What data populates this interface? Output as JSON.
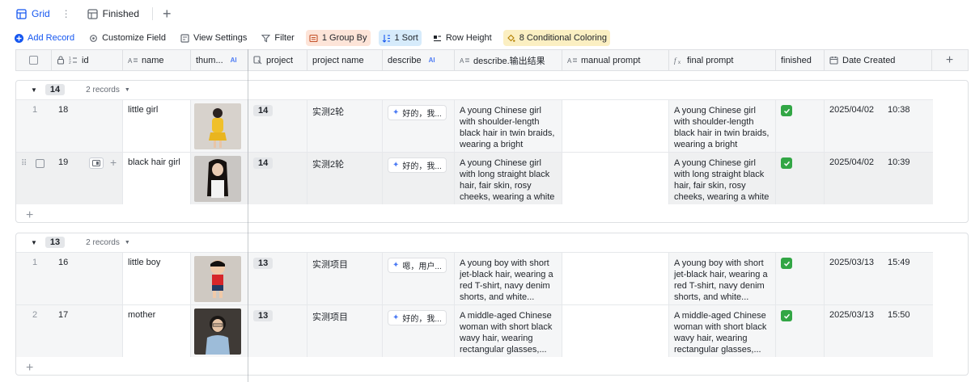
{
  "tabs": [
    {
      "label": "Grid",
      "icon": "grid-icon",
      "active": true
    },
    {
      "label": "Finished",
      "icon": "table-icon",
      "active": false
    }
  ],
  "toolbar": {
    "add_record": "Add Record",
    "customize_field": "Customize Field",
    "view_settings": "View Settings",
    "filter": "Filter",
    "group_by": "1 Group By",
    "sort": "1 Sort",
    "row_height": "Row Height",
    "conditional_coloring": "8 Conditional Coloring"
  },
  "columns": {
    "id": "id",
    "name": "name",
    "thumb": "thum...",
    "project": "project",
    "project_name": "project name",
    "describe": "describe",
    "describe_result": "describe.输出结果",
    "manual_prompt": "manual prompt",
    "final_prompt": "final prompt",
    "finished": "finished",
    "date_created": "Date Created",
    "ai_badge": "AI"
  },
  "groups": [
    {
      "value": "14",
      "count": "2 records",
      "rows": [
        {
          "idx": "1",
          "id": "18",
          "name": "little girl",
          "project": "14",
          "project_name": "实测2轮",
          "describe": "好的，我...",
          "result": "A young Chinese girl with shoulder-length black hair in twin braids, wearing a bright yellow...",
          "final": "A young Chinese girl with shoulder-length black hair in twin braids, wearing a bright yellow...",
          "finished": true,
          "date": "2025/04/02",
          "time": "10:38"
        },
        {
          "idx": "",
          "id": "19",
          "name": "black hair girl",
          "project": "14",
          "project_name": "实测2轮",
          "describe": "好的，我...",
          "result": "A young Chinese girl with long straight black hair, fair skin, rosy cheeks, wearing a white blouse...",
          "final": "A young Chinese girl with long straight black hair, fair skin, rosy cheeks, wearing a white blouse...",
          "finished": true,
          "date": "2025/04/02",
          "time": "10:39"
        }
      ]
    },
    {
      "value": "13",
      "count": "2 records",
      "rows": [
        {
          "idx": "1",
          "id": "16",
          "name": "little boy",
          "project": "13",
          "project_name": "实测项目",
          "describe": "嗯，用户...",
          "result": "A young boy with short jet-black hair, wearing a red T-shirt, navy denim shorts, and white...",
          "final": "A young boy with short jet-black hair, wearing a red T-shirt, navy denim shorts, and white...",
          "finished": true,
          "date": "2025/03/13",
          "time": "15:49"
        },
        {
          "idx": "2",
          "id": "17",
          "name": "mother",
          "project": "13",
          "project_name": "实测项目",
          "describe": "好的，我...",
          "result": "A middle-aged Chinese woman with short black wavy hair, wearing rectangular glasses,...",
          "final": "A middle-aged Chinese woman with short black wavy hair, wearing rectangular glasses,...",
          "finished": true,
          "date": "2025/03/13",
          "time": "15:50"
        }
      ]
    }
  ]
}
